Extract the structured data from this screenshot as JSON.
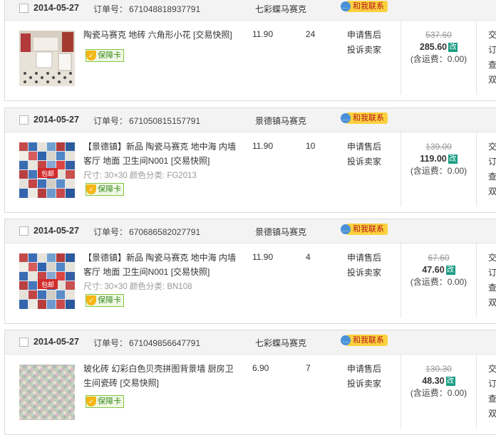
{
  "labels": {
    "order_no": "订单号：",
    "contact": "和我联系",
    "guarantee": "保障卡",
    "apply_after_sale": "申请售后",
    "complain_seller": "投诉卖家",
    "modify": "改",
    "freight": "(含运费：0.00)",
    "sku_size": "尺寸:",
    "sku_color": "颜色分类:",
    "status_lines": [
      "交",
      "订",
      "查",
      "双"
    ],
    "free_shipping": "包邮"
  },
  "orders": [
    {
      "date": "2014-05-27",
      "order_no": "671048818937791",
      "shop": "七彩蝶马赛克",
      "title": "陶瓷马赛克 地砖 六角形小花 [交易快照]",
      "sku": null,
      "price": "11.90",
      "qty": "24",
      "orig_total": "537.60",
      "paid_total": "285.60"
    },
    {
      "date": "2014-05-27",
      "order_no": "671050815157791",
      "shop": "景德镇马赛克",
      "title": "【景德镇】新品 陶瓷马赛克 地中海 内墙客厅 地面 卫生间N001 [交易快照]",
      "sku": {
        "size": "30×30",
        "color": "FG2013"
      },
      "price": "11.90",
      "qty": "10",
      "orig_total": "139.00",
      "paid_total": "119.00"
    },
    {
      "date": "2014-05-27",
      "order_no": "670686582027791",
      "shop": "景德镇马赛克",
      "title": "【景德镇】新品 陶瓷马赛克 地中海 内墙客厅 地面 卫生间N001 [交易快照]",
      "sku": {
        "size": "30×30",
        "color": "BN108"
      },
      "price": "11.90",
      "qty": "4",
      "orig_total": "67.60",
      "paid_total": "47.60"
    },
    {
      "date": "2014-05-27",
      "order_no": "671049856647791",
      "shop": "七彩蝶马赛克",
      "title": "玻化砖 幻彩白色贝壳拼图背景墙 厨房卫生间瓷砖 [交易快照]",
      "sku": null,
      "price": "6.90",
      "qty": "7",
      "orig_total": "130.30",
      "paid_total": "48.30"
    }
  ]
}
